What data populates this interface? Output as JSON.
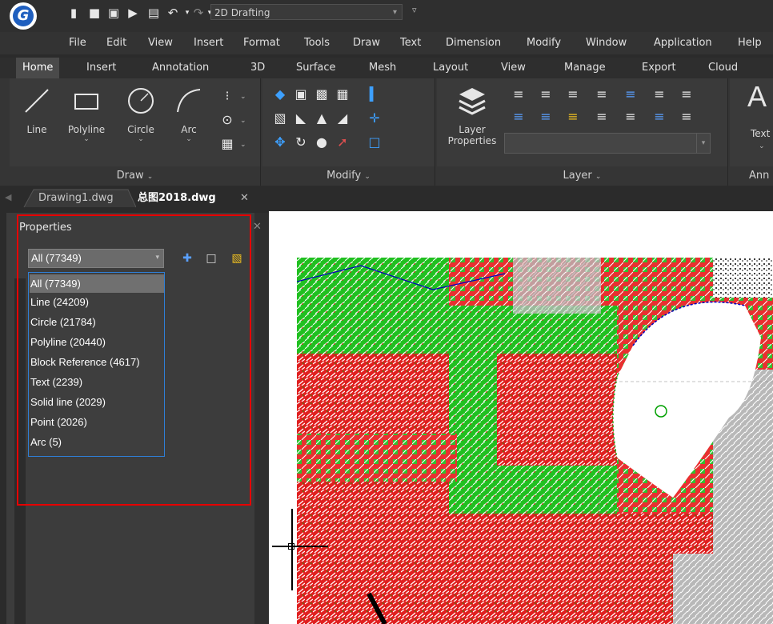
{
  "app": {
    "workspace": "2D Drafting",
    "logo_letter": "G"
  },
  "menu": [
    "File",
    "Edit",
    "View",
    "Insert",
    "Format",
    "Tools",
    "Draw",
    "Text",
    "Dimension",
    "Modify",
    "Window",
    "Application",
    "Help"
  ],
  "ribbon_tabs": [
    "Home",
    "Insert",
    "Annotation",
    "3D",
    "Surface",
    "Mesh",
    "Layout",
    "View",
    "Manage",
    "Export",
    "Cloud"
  ],
  "draw_panel": {
    "title": "Draw",
    "line": "Line",
    "polyline": "Polyline",
    "circle": "Circle",
    "arc": "Arc"
  },
  "modify_panel": {
    "title": "Modify"
  },
  "layer_panel": {
    "title": "Layer",
    "layer_props_l1": "Layer",
    "layer_props_l2": "Properties"
  },
  "anno_panel": {
    "title": "Ann",
    "big_letter": "A",
    "text_label": "Text"
  },
  "doc_tabs": [
    "Drawing1.dwg",
    "总图2018.dwg"
  ],
  "properties": {
    "title": "Properties",
    "selected": "All (77349)",
    "options": [
      "All (77349)",
      "Line (24209)",
      "Circle (21784)",
      "Polyline (20440)",
      "Block Reference (4617)",
      "Text (2239)",
      "Solid line (2029)",
      "Point (2026)",
      "Arc (5)"
    ]
  },
  "colors": {
    "highlight": "#e60000",
    "dropdown_border": "#2f7fd6",
    "logo": "#1f5fbf"
  }
}
